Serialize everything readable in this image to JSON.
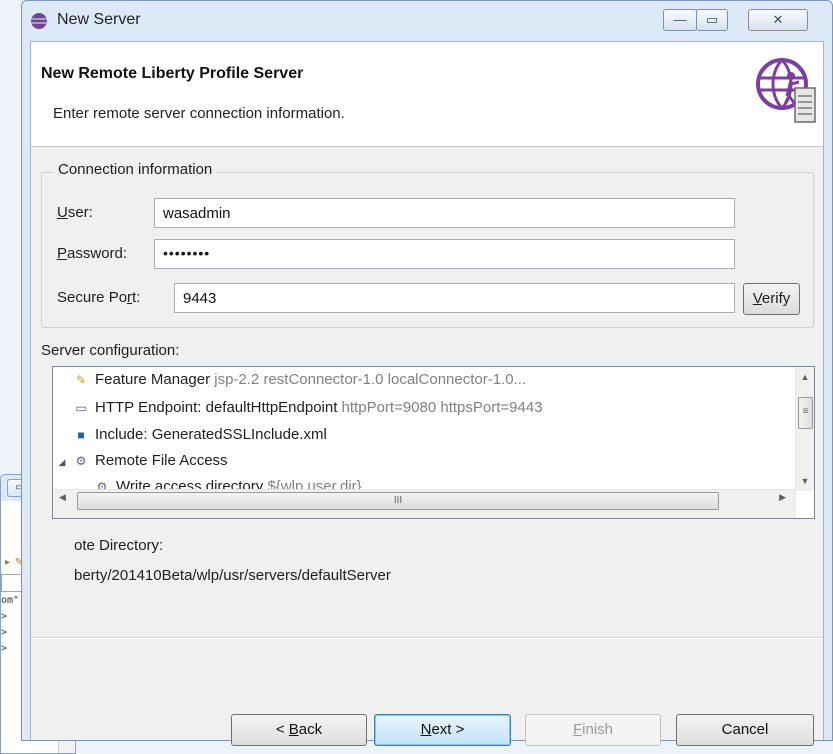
{
  "window": {
    "title": "New Server",
    "minimize_glyph": "—",
    "maximize_glyph": "▭",
    "close_glyph": "✕"
  },
  "header": {
    "title": "New Remote Liberty Profile Server",
    "description": "Enter remote server connection information.",
    "logo_icon": "liberty-globe-server-icon"
  },
  "connection": {
    "legend": "Connection information",
    "user_label_mnemonic": "U",
    "user_label_rest": "ser:",
    "user_value": "wasadmin",
    "password_label_mnemonic": "P",
    "password_label_rest": "assword:",
    "password_value": "••••••••",
    "port_label_pre": "Secure Po",
    "port_label_mnemonic": "r",
    "port_label_rest": "t:",
    "port_value": "9443",
    "verify_label_mnemonic": "V",
    "verify_label_rest": "erify"
  },
  "server_config": {
    "label": "Server configuration:",
    "rows": [
      {
        "icon": "feature-manager-icon",
        "name": "Feature Manager",
        "detail": "jsp-2.2 restConnector-1.0 localConnector-1.0..."
      },
      {
        "icon": "http-endpoint-icon",
        "name": "HTTP Endpoint: defaultHttpEndpoint",
        "detail": "httpPort=9080 httpsPort=9443"
      },
      {
        "icon": "include-icon",
        "name": "Include: GeneratedSSLInclude.xml",
        "detail": ""
      },
      {
        "icon": "remote-file-access-icon",
        "name": "Remote File Access",
        "detail": ""
      },
      {
        "icon": "write-access-icon",
        "name": "Write access directory",
        "detail": "${wlp.user.dir}"
      }
    ],
    "hscroll_grip": "III",
    "vscroll_grip": "≡"
  },
  "remote": {
    "label": "ote Directory:",
    "value": "berty/201410Beta/wlp/usr/servers/defaultServer"
  },
  "buttons": {
    "back_pre": "< ",
    "back_mnemonic": "B",
    "back_rest": "ack",
    "next_mnemonic": "N",
    "next_rest": "ext >",
    "finish_mnemonic": "F",
    "finish_rest": "inish",
    "cancel": "Cancel"
  },
  "background_window": {
    "max_glyph": "▭",
    "close_glyph": "✕",
    "list_lines": [
      "om\"",
      "",
      ">",
      "",
      ">",
      ">"
    ]
  }
}
